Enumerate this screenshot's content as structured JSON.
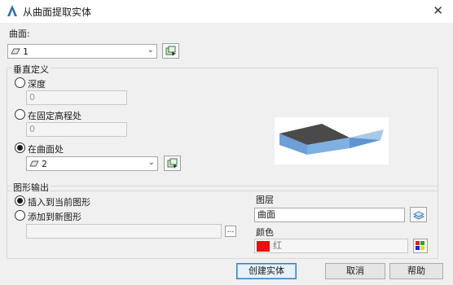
{
  "window": {
    "title": "从曲面提取实体",
    "icon": "autocad-a-icon",
    "close_icon": "close-icon"
  },
  "surface": {
    "label": "曲面:",
    "selected": "1",
    "select_icon": "select-objects-icon"
  },
  "vertical": {
    "group_title": "垂直定义",
    "options": [
      {
        "label": "深度",
        "checked": false,
        "value": "0"
      },
      {
        "label": "在固定高程处",
        "checked": false,
        "value": "0"
      },
      {
        "label": "在曲面处",
        "checked": true,
        "value": "2"
      }
    ]
  },
  "output": {
    "group_title": "图形输出",
    "options": [
      {
        "label": "插入到当前图形",
        "checked": true
      },
      {
        "label": "添加到新图形",
        "checked": false
      }
    ],
    "browse_label": "...",
    "layer_label": "图层",
    "layer_value": "曲面",
    "color_label": "颜色",
    "color_value": "红",
    "color_hex": "#e81010"
  },
  "buttons": {
    "create": "创建实体",
    "cancel": "取消",
    "help": "帮助"
  }
}
